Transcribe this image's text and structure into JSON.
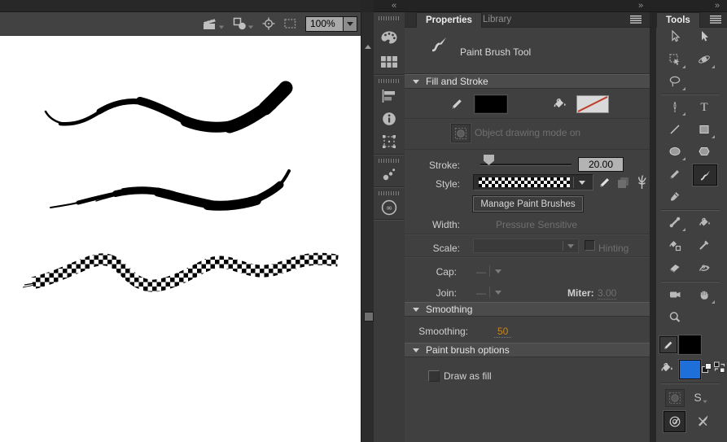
{
  "stage": {
    "zoom_level": "100%",
    "strokes": [
      {
        "name": "smooth-taper-brush-stroke",
        "color": "#000000"
      },
      {
        "name": "rough-art-brush-stroke",
        "color": "#000000"
      },
      {
        "name": "checkered-pattern-brush-stroke",
        "color": "#000000"
      }
    ]
  },
  "dock": {
    "collapse_chevron": "«",
    "expand_chevron": "»"
  },
  "properties_panel": {
    "tabs": [
      {
        "label": "Properties",
        "active": true
      },
      {
        "label": "Library",
        "active": false
      }
    ],
    "tool_name": "Paint Brush Tool",
    "fill_and_stroke": {
      "title": "Fill and Stroke",
      "stroke_color": "#000000",
      "fill": "none",
      "object_drawing_label": "Object drawing mode on",
      "stroke_label": "Stroke:",
      "stroke_value": "20.00",
      "style_label": "Style:",
      "style_preview": "checkered-brush",
      "manage_paint_brushes_label": "Manage Paint Brushes",
      "width_label": "Width:",
      "width_value": "Pressure Sensitive",
      "scale_label": "Scale:",
      "hinting_label": "Hinting",
      "cap_label": "Cap:",
      "cap_value": "—",
      "join_label": "Join:",
      "join_value": "—",
      "miter_label": "Miter:",
      "miter_value": "3.00"
    },
    "smoothing": {
      "title": "Smoothing",
      "label": "Smoothing:",
      "value": "50"
    },
    "paint_brush_options": {
      "title": "Paint brush options",
      "draw_as_fill_label": "Draw as fill",
      "draw_as_fill_checked": false
    }
  },
  "tools_panel": {
    "tab_label": "Tools",
    "selected_tool": "paint-brush-tool",
    "stroke_color": "#000000",
    "fill_color": "#1e6fd9",
    "snap_label": "S",
    "tools": [
      "selection",
      "subselection",
      "free-transform",
      "3d-rotation",
      "lasso",
      "pen",
      "text",
      "line",
      "rectangle",
      "oval",
      "polystar",
      "pencil",
      "paint-brush",
      "classic-brush",
      "bone",
      "paint-bucket",
      "ink-bottle",
      "eyedropper",
      "eraser",
      "asset-warp",
      "camera",
      "hand",
      "zoom"
    ]
  },
  "colors": {
    "accent_orange": "#c8861e",
    "fill_blue": "#1e6fd9",
    "no_fill_slash": "#cc4444",
    "panel_bg": "#404040",
    "header_bg": "#4b4b4b"
  },
  "icons": {
    "edit-scene-icon": "clapperboard",
    "edit-symbols-icon": "square-circle",
    "center-frame-icon": "crosshair",
    "clip-content-icon": "dashed-rect",
    "zoom-arrow-icon": "triangle-down",
    "panel-menu-icon": "hamburger",
    "color-panel-icon": "palette",
    "swatches-panel-icon": "grid",
    "align-panel-icon": "bars",
    "info-panel-icon": "circle-i",
    "transform-panel-icon": "dashed-square-handles",
    "presets-panel-icon": "rising-dots",
    "cc-libraries-panel-icon": "cc-circle",
    "paint-brush-tool-icon": "curved-brush",
    "stroke-color-icon": "pencil",
    "fill-color-icon": "paint-bucket",
    "no-fill-icon": "red-slash-swatch",
    "object-drawing-icon": "dashed-square-circle",
    "edit-style-icon": "pencil",
    "layered-squares-icon": "stacked-squares",
    "paint-brush-library-icon": "brush-fan",
    "default-colors-icon": "black-white-squares",
    "swap-colors-icon": "swap-squares",
    "snap-options-icon": "letter-S-caret",
    "use-tilt-icon": "target-check",
    "use-pressure-icon": "crossed-pen"
  }
}
